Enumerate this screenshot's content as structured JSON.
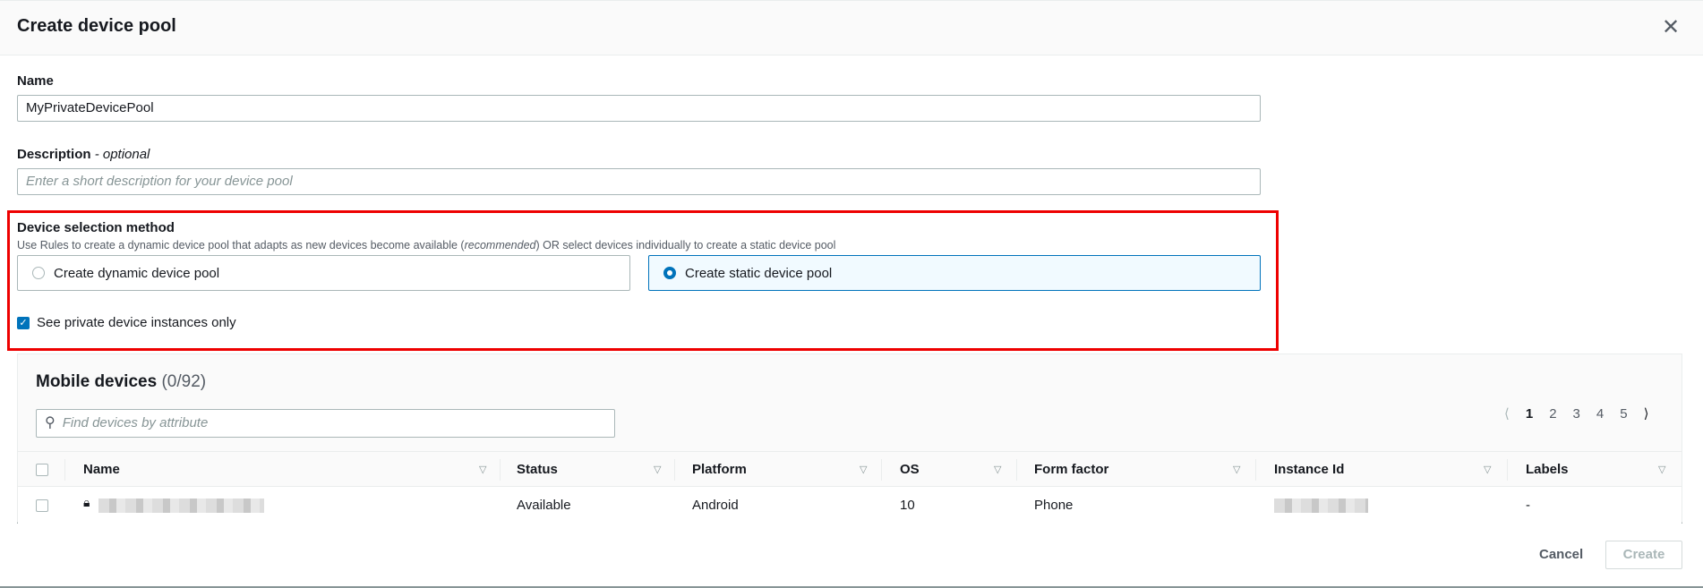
{
  "modal": {
    "title": "Create device pool"
  },
  "name_field": {
    "label": "Name",
    "value": "MyPrivateDevicePool"
  },
  "description_field": {
    "label": "Description",
    "optional": "- optional",
    "placeholder": "Enter a short description for your device pool"
  },
  "selection": {
    "label": "Device selection method",
    "help_pre": "Use Rules to create a dynamic device pool that adapts as new devices become available (",
    "help_em": "recommended",
    "help_post": ") OR select devices individually to create a static device pool",
    "options": [
      {
        "label": "Create dynamic device pool",
        "selected": false
      },
      {
        "label": "Create static device pool",
        "selected": true
      }
    ],
    "private_only": {
      "label": "See private device instances only",
      "checked": true
    }
  },
  "devices": {
    "title": "Mobile devices",
    "count": "(0/92)",
    "search_placeholder": "Find devices by attribute",
    "pages": [
      "1",
      "2",
      "3",
      "4",
      "5"
    ],
    "current_page": "1",
    "columns": [
      "Name",
      "Status",
      "Platform",
      "OS",
      "Form factor",
      "Instance Id",
      "Labels"
    ],
    "rows": [
      {
        "status": "Available",
        "platform": "Android",
        "os": "10",
        "form_factor": "Phone",
        "labels": "-"
      }
    ]
  },
  "footer": {
    "cancel": "Cancel",
    "create": "Create"
  }
}
